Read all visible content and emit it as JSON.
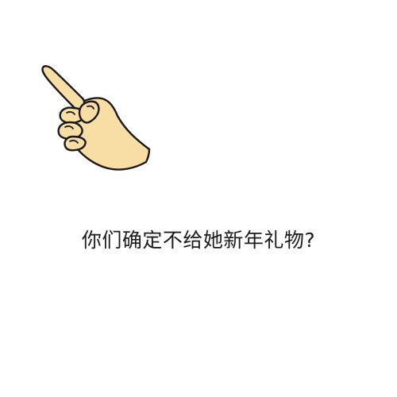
{
  "caption": "你们确定不给她新年礼物?",
  "illustration": {
    "icon": "pointing-hand-icon",
    "skin_color": "#F8DDA4",
    "outline_color": "#1a1a1a"
  }
}
